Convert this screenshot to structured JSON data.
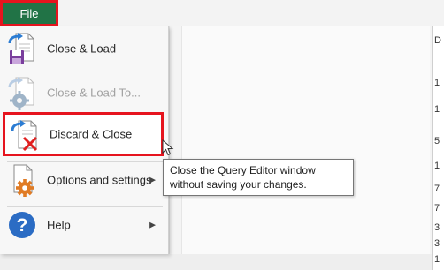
{
  "ribbon": {
    "file_tab_label": "File"
  },
  "file_menu": {
    "items": [
      {
        "id": "close-load",
        "label": "Close & Load",
        "icon": "close-and-load-icon",
        "enabled": true
      },
      {
        "id": "close-load-to",
        "label": "Close & Load To...",
        "icon": "close-and-load-to-icon",
        "enabled": false
      },
      {
        "id": "discard-close",
        "label": "Discard & Close",
        "icon": "discard-and-close-icon",
        "enabled": true,
        "highlighted": true
      },
      {
        "id": "options-settings",
        "label": "Options and settings",
        "icon": "options-gear-icon",
        "enabled": true,
        "submenu": true
      },
      {
        "id": "help",
        "label": "Help",
        "icon": "help-icon",
        "enabled": true,
        "submenu": true
      }
    ],
    "submenu_arrow": "▶"
  },
  "tooltip": {
    "line1": "Close the Query Editor window",
    "line2": "without saving your changes."
  },
  "background_edge_letters": [
    "D",
    "1",
    "1",
    "5",
    "1",
    "7",
    "7",
    "3",
    "3",
    "1"
  ],
  "colors": {
    "highlight_border": "#e6141e",
    "file_tab_bg": "#217346",
    "arrow_blue": "#2b7cd3",
    "disk_purple": "#7a3e9d",
    "gear_orange": "#e07b24",
    "help_blue": "#2b6cc4",
    "discard_red": "#e02020"
  }
}
